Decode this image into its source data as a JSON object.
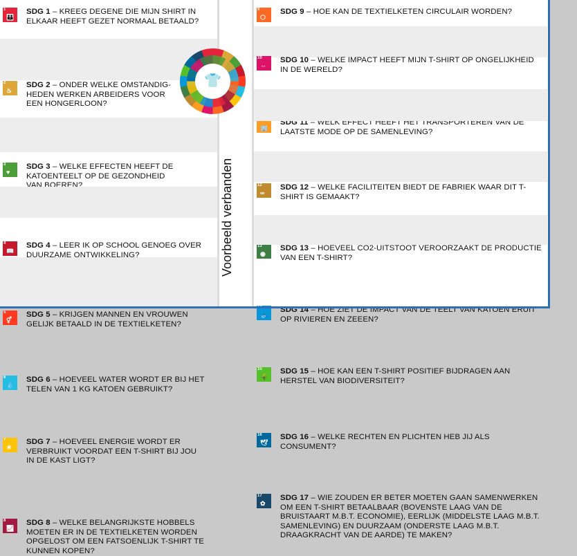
{
  "vertical_label": "Voorbeeld verbanden",
  "center_glyph": "👕",
  "left": [
    {
      "code": "SDG 1",
      "num": "1",
      "icon": "people-icon",
      "glyph": "👪",
      "color": "#e5243b",
      "text": " – KREEG DEGENE DIE MIJN SHIRT IN ELKAAR HEEFT GEZET NORMAAL BETAALD?"
    },
    {
      "code": "SDG 2",
      "num": "2",
      "icon": "bowl-icon",
      "glyph": "♨",
      "color": "#dda63a",
      "text": " – ONDER WELKE OMSTANDIG-HEDEN WERKEN ARBEIDERS VOOR EEN HONGERLOON?"
    },
    {
      "code": "SDG 3",
      "num": "3",
      "icon": "heartbeat-icon",
      "glyph": "♥",
      "color": "#4c9f38",
      "text": " – WELKE EFFECTEN HEEFT DE KATOENTEELT OP DE GEZONDHEID VAN BOEREN?"
    },
    {
      "code": "SDG 4",
      "num": "4",
      "icon": "book-icon",
      "glyph": "📖",
      "color": "#c5192d",
      "text": " – LEER IK OP SCHOOL GENOEG OVER DUURZAME ONTWIKKELING?"
    },
    {
      "code": "SDG 5",
      "num": "5",
      "icon": "gender-icon",
      "glyph": "⚥",
      "color": "#ff3a21",
      "text": " – KRIJGEN MANNEN EN VROUWEN GELIJK BETAALD IN DE TEXTIELKETEN?"
    },
    {
      "code": "SDG 6",
      "num": "6",
      "icon": "water-icon",
      "glyph": "💧",
      "color": "#26bde2",
      "text": " – HOEVEEL WATER WORDT ER BIJ HET TELEN VAN 1 KG KATOEN GEBRUIKT?"
    },
    {
      "code": "SDG 7",
      "num": "7",
      "icon": "sun-icon",
      "glyph": "☀",
      "color": "#fcc30b",
      "text": " – HOEVEEL ENERGIE WORDT ER VERBRUIKT VOORDAT EEN T-SHIRT BIJ JOU IN DE KAST LIGT?"
    },
    {
      "code": "SDG 8",
      "num": "8",
      "icon": "growth-chart-icon",
      "glyph": "📈",
      "color": "#a21942",
      "text": " – WELKE BELANGRIJKSTE HOBBELS MOETEN ER IN DE TEXTIELKETEN WORDEN OPGELOST OM EEN FATSOENLIJK T-SHIRT TE KUNNEN KOPEN?"
    }
  ],
  "right": [
    {
      "code": "SDG 9",
      "num": "9",
      "icon": "cubes-icon",
      "glyph": "⬡",
      "color": "#fd6925",
      "text": " – HOE KAN DE TEXTIELKETEN CIRCULAIR WORDEN?"
    },
    {
      "code": "SDG 10",
      "num": "10",
      "icon": "equality-icon",
      "glyph": "⇔",
      "color": "#dd1367",
      "text": " – WELKE IMPACT HEEFT MIJN T-SHIRT OP ONGELIJKHEID IN DE WERELD?"
    },
    {
      "code": "SDG 11",
      "num": "11",
      "icon": "city-icon",
      "glyph": "🏢",
      "color": "#fd9d24",
      "text": " – WELK EFFECT HEEFT HET TRANSPORTEREN VAN DE LAATSTE MODE OP DE SAMENLEVING?"
    },
    {
      "code": "SDG 12",
      "num": "12",
      "icon": "infinity-icon",
      "glyph": "∞",
      "color": "#bf8b2e",
      "text": " – WELKE FACILITEITEN BIEDT DE FABRIEK WAAR DIT T-SHIRT IS GEMAAKT?"
    },
    {
      "code": "SDG 13",
      "num": "13",
      "icon": "eye-globe-icon",
      "glyph": "◉",
      "color": "#3f7e44",
      "text": " – HOEVEEL CO2-UITSTOOT VEROORZAAKT DE PRODUCTIE VAN EEN T-SHIRT?"
    },
    {
      "code": "SDG 14",
      "num": "14",
      "icon": "fish-icon",
      "glyph": "🐟",
      "color": "#0a97d9",
      "text": " – HOE ZIET DE IMPACT VAN DE TEELT VAN KATOEN ERUIT OP RIVIEREN EN ZEEEN?"
    },
    {
      "code": "SDG 15",
      "num": "15",
      "icon": "tree-icon",
      "glyph": "🌳",
      "color": "#56c02b",
      "text": " – HOE KAN EEN T-SHIRT POSITIEF BIJDRAGEN AAN HERSTEL VAN BIODIVERSITEIT?"
    },
    {
      "code": "SDG 16",
      "num": "16",
      "icon": "dove-icon",
      "glyph": "🕊",
      "color": "#00689d",
      "text": " – WELKE RECHTEN EN PLICHTEN HEB JIJ ALS CONSUMENT?"
    },
    {
      "code": "SDG 17",
      "num": "17",
      "icon": "flower-icon",
      "glyph": "✿",
      "color": "#19486a",
      "text": " – WIE ZOUDEN ER BETER MOETEN GAAN SAMENWERKEN OM EEN T-SHIRT BETAALBAAR (BOVENSTE LAAG VAN DE BRUISTAART M.B.T. ECONOMIE), EERLIJK (MIDDELSTE LAAG M.B.T. SAMENLEVING) EN DUURZAAM (ONDERSTE LAAG M.B.T. DRAAGKRACHT VAN DE AARDE) TE MAKEN?"
    }
  ]
}
